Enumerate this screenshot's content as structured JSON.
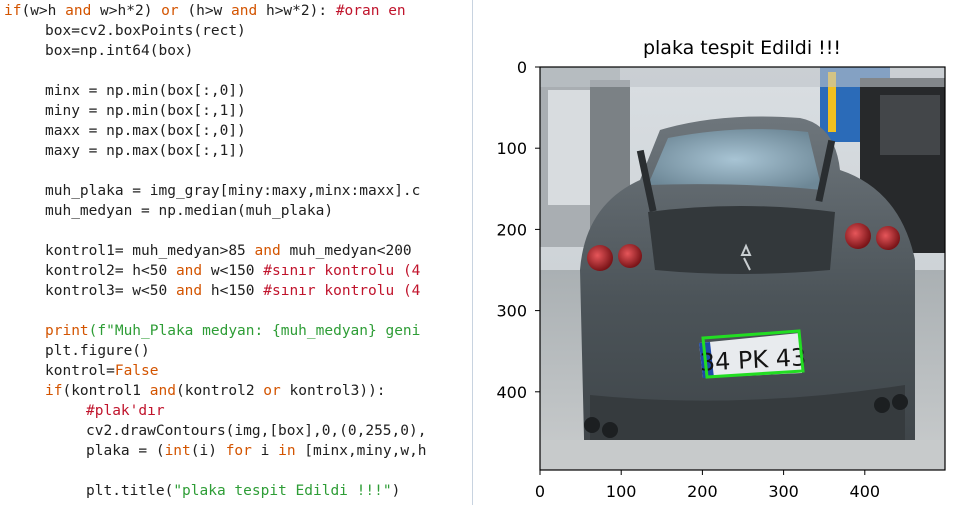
{
  "code_lines": [
    {
      "indent": 0,
      "segments": [
        {
          "t": "if",
          "c": "kw"
        },
        {
          "t": "(w>h ",
          "c": ""
        },
        {
          "t": "and",
          "c": "kw"
        },
        {
          "t": " w>h*2) ",
          "c": ""
        },
        {
          "t": "or",
          "c": "kw"
        },
        {
          "t": " (h>w ",
          "c": ""
        },
        {
          "t": "and",
          "c": "kw"
        },
        {
          "t": " h>w*2): ",
          "c": ""
        },
        {
          "t": "#oran en",
          "c": "cm"
        }
      ]
    },
    {
      "indent": 1,
      "segments": [
        {
          "t": "box=cv2.boxPoints(rect)",
          "c": ""
        }
      ]
    },
    {
      "indent": 1,
      "segments": [
        {
          "t": "box=np.int64(box)",
          "c": ""
        }
      ]
    },
    {
      "indent": 1,
      "segments": []
    },
    {
      "indent": 1,
      "segments": [
        {
          "t": "minx = np.min(box[:,0])",
          "c": ""
        }
      ]
    },
    {
      "indent": 1,
      "segments": [
        {
          "t": "miny = np.min(box[:,1])",
          "c": ""
        }
      ]
    },
    {
      "indent": 1,
      "segments": [
        {
          "t": "maxx = np.max(box[:,0])",
          "c": ""
        }
      ]
    },
    {
      "indent": 1,
      "segments": [
        {
          "t": "maxy = np.max(box[:,1])",
          "c": ""
        }
      ]
    },
    {
      "indent": 1,
      "segments": []
    },
    {
      "indent": 1,
      "segments": [
        {
          "t": "muh_plaka = img_gray[miny:maxy,minx:maxx].c",
          "c": ""
        }
      ]
    },
    {
      "indent": 1,
      "segments": [
        {
          "t": "muh_medyan = np.median(muh_plaka)",
          "c": ""
        }
      ]
    },
    {
      "indent": 1,
      "segments": []
    },
    {
      "indent": 1,
      "segments": [
        {
          "t": "kontrol1= muh_medyan>85 ",
          "c": ""
        },
        {
          "t": "and",
          "c": "kw"
        },
        {
          "t": " muh_medyan<200",
          "c": ""
        }
      ]
    },
    {
      "indent": 1,
      "segments": [
        {
          "t": "kontrol2= h<50 ",
          "c": ""
        },
        {
          "t": "and",
          "c": "kw"
        },
        {
          "t": " w<150 ",
          "c": ""
        },
        {
          "t": "#sınır kontrolu (4",
          "c": "cm"
        }
      ]
    },
    {
      "indent": 1,
      "segments": [
        {
          "t": "kontrol3= w<50 ",
          "c": ""
        },
        {
          "t": "and",
          "c": "kw"
        },
        {
          "t": " h<150 ",
          "c": ""
        },
        {
          "t": "#sınır kontrolu (4",
          "c": "cm"
        }
      ]
    },
    {
      "indent": 1,
      "segments": []
    },
    {
      "indent": 1,
      "segments": [
        {
          "t": "print",
          "c": "kw"
        },
        {
          "t": "(f\"Muh_Plaka medyan: {muh_medyan} geni",
          "c": "str"
        }
      ]
    },
    {
      "indent": 1,
      "segments": [
        {
          "t": "plt.figure()",
          "c": ""
        }
      ]
    },
    {
      "indent": 1,
      "segments": [
        {
          "t": "kontrol=",
          "c": ""
        },
        {
          "t": "False",
          "c": "kw"
        }
      ]
    },
    {
      "indent": 1,
      "segments": [
        {
          "t": "if",
          "c": "kw"
        },
        {
          "t": "(kontrol1 ",
          "c": ""
        },
        {
          "t": "and",
          "c": "kw"
        },
        {
          "t": "(kontrol2 ",
          "c": ""
        },
        {
          "t": "or",
          "c": "kw"
        },
        {
          "t": " kontrol3)):",
          "c": ""
        }
      ]
    },
    {
      "indent": 2,
      "segments": [
        {
          "t": "#plak'dır",
          "c": "cm"
        }
      ]
    },
    {
      "indent": 2,
      "segments": [
        {
          "t": "cv2.drawContours(img,[box],0,(0,255,0),",
          "c": ""
        }
      ]
    },
    {
      "indent": 2,
      "segments": [
        {
          "t": "plaka = (",
          "c": ""
        },
        {
          "t": "int",
          "c": "kw"
        },
        {
          "t": "(i) ",
          "c": ""
        },
        {
          "t": "for",
          "c": "kw"
        },
        {
          "t": " i ",
          "c": ""
        },
        {
          "t": "in",
          "c": "kw"
        },
        {
          "t": " [minx,miny,w,h",
          "c": ""
        }
      ]
    },
    {
      "indent": 2,
      "segments": []
    },
    {
      "indent": 2,
      "segments": [
        {
          "t": "plt.title(",
          "c": ""
        },
        {
          "t": "\"plaka tespit Edildi !!!\"",
          "c": "str"
        },
        {
          "t": ")",
          "c": ""
        }
      ]
    }
  ],
  "plot": {
    "title": "plaka tespit Edildi !!!",
    "plate_text": "34 PK 43",
    "highlight_color": "#22dd22",
    "x_ticks": [
      "0",
      "100",
      "200",
      "300",
      "400"
    ],
    "y_ticks": [
      "0",
      "100",
      "200",
      "300",
      "400"
    ],
    "image_icon": "car-rear-photo"
  }
}
